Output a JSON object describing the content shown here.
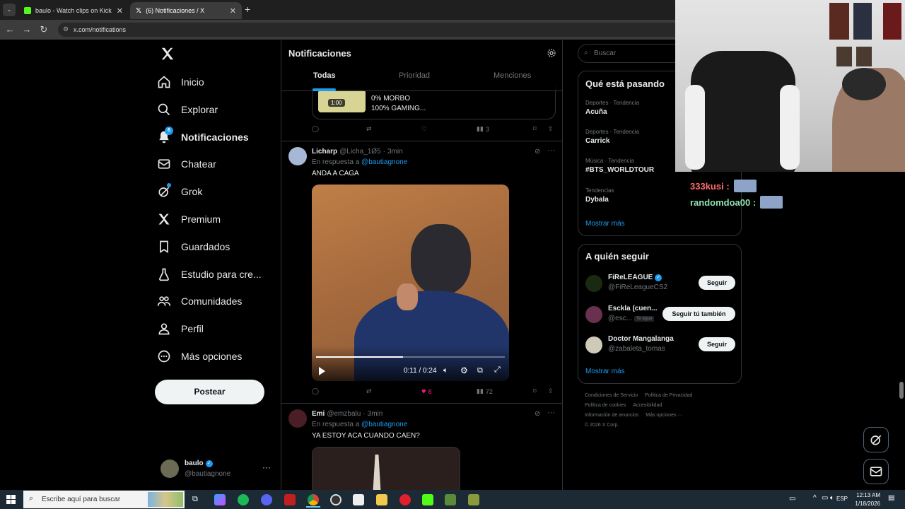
{
  "browser": {
    "tabs": [
      {
        "title": "baulo - Watch clips on Kick",
        "active": false
      },
      {
        "title": "(6) Notificaciones / X",
        "active": true
      }
    ],
    "url": "x.com/notifications"
  },
  "nav": {
    "items": [
      {
        "label": "Inicio",
        "icon": "home-icon"
      },
      {
        "label": "Explorar",
        "icon": "search-icon"
      },
      {
        "label": "Notificaciones",
        "icon": "bell-icon",
        "badge": "6"
      },
      {
        "label": "Chatear",
        "icon": "mail-icon"
      },
      {
        "label": "Grok",
        "icon": "grok-icon"
      },
      {
        "label": "Premium",
        "icon": "x-icon"
      },
      {
        "label": "Guardados",
        "icon": "bookmark-icon"
      },
      {
        "label": "Estudio para cre...",
        "icon": "flask-icon"
      },
      {
        "label": "Comunidades",
        "icon": "people-icon"
      },
      {
        "label": "Perfil",
        "icon": "person-icon"
      },
      {
        "label": "Más opciones",
        "icon": "more-circle-icon"
      }
    ],
    "post_label": "Postear",
    "profile": {
      "name": "baulo",
      "handle": "@bautiagnone"
    }
  },
  "center": {
    "title": "Notificaciones",
    "tabs": [
      "Todas",
      "Prioridad",
      "Menciones"
    ],
    "quote_preview": {
      "duration": "1:00",
      "line1": "0% MORBO",
      "line2": "100% GAMING..."
    },
    "first_post_actions": {
      "views": "3"
    },
    "posts": [
      {
        "name": "Licharp",
        "handle": "@Licha_1Ø5",
        "time": "3min",
        "reply_prefix": "En respuesta a",
        "reply_to": "@bautiagnone",
        "text": "ANDA A CAGA",
        "video_time": "0:11 / 0:24",
        "video_progress": 0.46,
        "likes": "8",
        "views": "72"
      },
      {
        "name": "Emi",
        "handle": "@emzbalu",
        "time": "3min",
        "reply_prefix": "En respuesta a",
        "reply_to": "@bautiagnone",
        "text": "YA ESTOY ACA CUANDO CAEN?"
      }
    ]
  },
  "right": {
    "search_placeholder": "Buscar",
    "trends_title": "Qué está pasando",
    "trends": [
      {
        "category": "Deportes · Tendencia",
        "topic": "Acuña"
      },
      {
        "category": "Deportes · Tendencia",
        "topic": "Carrick"
      },
      {
        "category": "Música · Tendencia",
        "topic": "#BTS_WORLDTOUR"
      },
      {
        "category": "Tendencias",
        "topic": "Dybala"
      }
    ],
    "show_more": "Mostrar más",
    "follow_title": "A quién seguir",
    "follow": [
      {
        "name": "FiReLEAGUE",
        "handle": "@FiReLeagueCS2",
        "button": "Seguir"
      },
      {
        "name": "Esckla (cuen...",
        "handle": "@esc...",
        "badge": "Te sigue",
        "button": "Seguir tú también"
      },
      {
        "name": "Doctor Mangalanga",
        "handle": "@zabaleta_tomas",
        "button": "Seguir"
      }
    ],
    "footer": [
      "Condiciones de Servicio",
      "Política de Privacidad",
      "Política de cookies",
      "Accesibilidad",
      "Información de anuncios",
      "Más opciones ···",
      "© 2026 X Corp."
    ]
  },
  "chat": [
    {
      "user": "333kusi :",
      "color": "#ff6b6b"
    },
    {
      "user": "randomdoa00 :",
      "color": "#8fe3b3"
    }
  ],
  "taskbar": {
    "search_placeholder": "Escribe aquí para buscar",
    "lang": "ESP",
    "time": "12:13 AM",
    "date": "1/18/2026"
  }
}
